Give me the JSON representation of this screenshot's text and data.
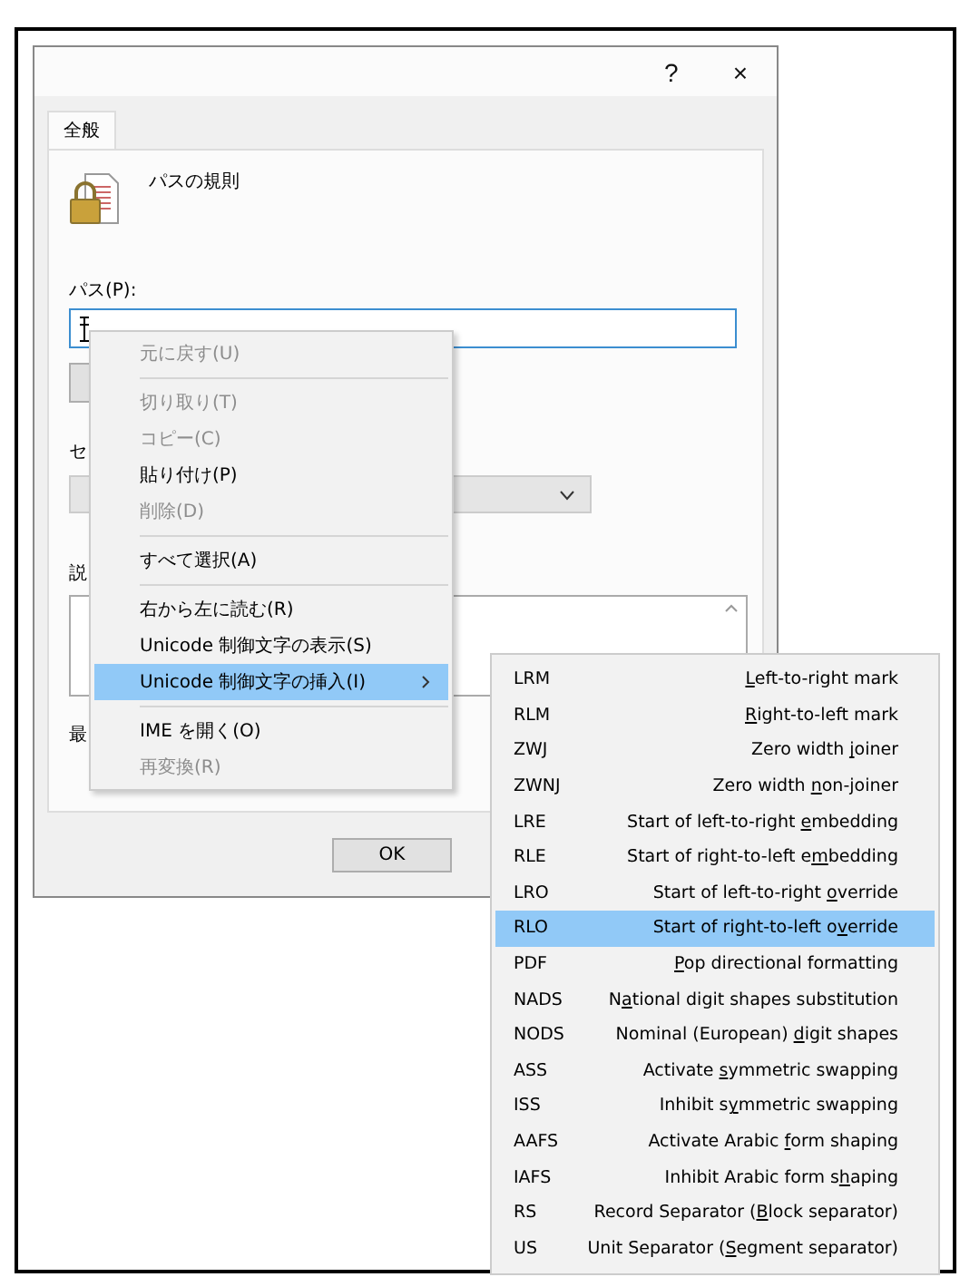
{
  "dialog": {
    "help_button": "?",
    "close_button": "×",
    "tabs": [
      {
        "label": "全般",
        "selected": true
      }
    ],
    "rule_title": "パスの規則",
    "path_label": "パス(P):",
    "security_label": "セ",
    "description_label": "説",
    "last_modified_label": "最",
    "ok_button": "OK"
  },
  "context_menu": [
    {
      "kind": "item",
      "label": "元に戻す(U)",
      "disabled": true,
      "selected": false,
      "submenu": false
    },
    {
      "kind": "separator"
    },
    {
      "kind": "item",
      "label": "切り取り(T)",
      "disabled": true,
      "selected": false,
      "submenu": false
    },
    {
      "kind": "item",
      "label": "コピー(C)",
      "disabled": true,
      "selected": false,
      "submenu": false
    },
    {
      "kind": "item",
      "label": "貼り付け(P)",
      "disabled": false,
      "selected": false,
      "submenu": false
    },
    {
      "kind": "item",
      "label": "削除(D)",
      "disabled": true,
      "selected": false,
      "submenu": false
    },
    {
      "kind": "separator"
    },
    {
      "kind": "item",
      "label": "すべて選択(A)",
      "disabled": false,
      "selected": false,
      "submenu": false
    },
    {
      "kind": "separator"
    },
    {
      "kind": "item",
      "label": "右から左に読む(R)",
      "disabled": false,
      "selected": false,
      "submenu": false
    },
    {
      "kind": "item",
      "label": "Unicode 制御文字の表示(S)",
      "disabled": false,
      "selected": false,
      "submenu": false
    },
    {
      "kind": "item",
      "label": "Unicode 制御文字の挿入(I)",
      "disabled": false,
      "selected": true,
      "submenu": true
    },
    {
      "kind": "separator"
    },
    {
      "kind": "item",
      "label": "IME を開く(O)",
      "disabled": false,
      "selected": false,
      "submenu": false
    },
    {
      "kind": "item",
      "label": "再変換(R)",
      "disabled": true,
      "selected": false,
      "submenu": false
    }
  ],
  "submenu": [
    {
      "code": "LRM",
      "label": {
        "key": "L",
        "after": "eft-to-right mark"
      },
      "selected": false
    },
    {
      "code": "RLM",
      "label": {
        "key": "R",
        "after": "ight-to-left mark"
      },
      "selected": false
    },
    {
      "code": "ZWJ",
      "label": {
        "before": "Zero width ",
        "key": "j",
        "after": "oiner"
      },
      "selected": false
    },
    {
      "code": "ZWNJ",
      "label": {
        "before": "Zero width ",
        "key": "n",
        "after": "on-joiner"
      },
      "selected": false
    },
    {
      "code": "LRE",
      "label": {
        "before": "Start of left-to-right ",
        "key": "e",
        "after": "mbedding"
      },
      "selected": false
    },
    {
      "code": "RLE",
      "label": {
        "before": "Start of right-to-left e",
        "key": "m",
        "after": "bedding"
      },
      "selected": false
    },
    {
      "code": "LRO",
      "label": {
        "before": "Start of left-to-right ",
        "key": "o",
        "after": "verride"
      },
      "selected": false
    },
    {
      "code": "RLO",
      "label": {
        "before": "Start of right-to-left o",
        "key": "v",
        "after": "erride"
      },
      "selected": true
    },
    {
      "code": "PDF",
      "label": {
        "key": "P",
        "after": "op directional formatting"
      },
      "selected": false
    },
    {
      "code": "NADS",
      "label": {
        "before": "N",
        "key": "a",
        "after": "tional digit shapes substitution"
      },
      "selected": false
    },
    {
      "code": "NODS",
      "label": {
        "before": "Nominal (European) ",
        "key": "d",
        "after": "igit shapes"
      },
      "selected": false
    },
    {
      "code": "ASS",
      "label": {
        "before": "Activate ",
        "key": "s",
        "after": "ymmetric swapping"
      },
      "selected": false
    },
    {
      "code": "ISS",
      "label": {
        "before": "Inhibit s",
        "key": "y",
        "after": "mmetric swapping"
      },
      "selected": false
    },
    {
      "code": "AAFS",
      "label": {
        "before": "Activate Arabic ",
        "key": "f",
        "after": "orm shaping"
      },
      "selected": false
    },
    {
      "code": "IAFS",
      "label": {
        "before": "Inhibit Arabic form s",
        "key": "h",
        "after": "aping"
      },
      "selected": false
    },
    {
      "code": "RS",
      "label": {
        "before": "Record Separator (",
        "key": "B",
        "after": "lock separator)"
      },
      "selected": false
    },
    {
      "code": "US",
      "label": {
        "before": "Unit Separator (",
        "key": "S",
        "after": "egment separator)"
      },
      "selected": false
    }
  ]
}
